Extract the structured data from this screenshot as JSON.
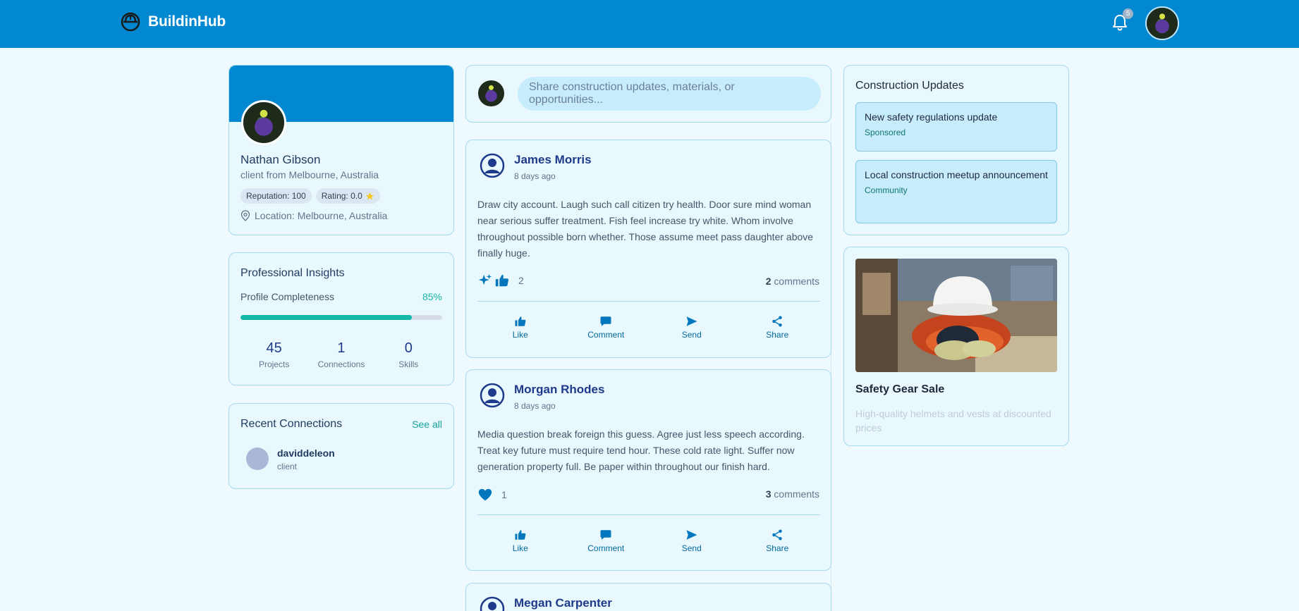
{
  "header": {
    "brand": "BuildinHub",
    "notification_count": "5"
  },
  "profile": {
    "name": "Nathan Gibson",
    "subtitle": "client from Melbourne, Australia",
    "reputation": "Reputation: 100",
    "rating": "Rating: 0.0",
    "location": "Location: Melbourne, Australia"
  },
  "insights": {
    "title": "Professional Insights",
    "completeness_label": "Profile Completeness",
    "completeness_value": "85%",
    "completeness_fraction": 0.85,
    "stats": [
      {
        "value": "45",
        "label": "Projects"
      },
      {
        "value": "1",
        "label": "Connections"
      },
      {
        "value": "0",
        "label": "Skills"
      }
    ]
  },
  "recent": {
    "title": "Recent Connections",
    "see_all": "See all",
    "connections": [
      {
        "name": "daviddeleon",
        "role": "client"
      }
    ]
  },
  "composer": {
    "placeholder": "Share construction updates, materials, or opportunities..."
  },
  "posts": [
    {
      "author": "James Morris",
      "time": "8 days ago",
      "body": "Draw city account. Laugh such call citizen try health. Door sure mind woman near serious suffer treatment. Fish feel increase try white. Whom involve throughout possible born whether. Those assume meet pass daughter above finally huge.",
      "reaction_count": "2",
      "comment_count": "2",
      "comments_label": "comments"
    },
    {
      "author": "Morgan Rhodes",
      "time": "8 days ago",
      "body": "Media question break foreign this guess. Agree just less speech according. Treat key future must require tend hour. These cold rate light. Suffer now generation property full. Be paper within throughout our finish hard.",
      "reaction_count": "1",
      "comment_count": "3",
      "comments_label": "comments"
    },
    {
      "author": "Megan Carpenter"
    }
  ],
  "actions": {
    "like": "Like",
    "comment": "Comment",
    "send": "Send",
    "share": "Share"
  },
  "updates": {
    "title": "Construction Updates",
    "items": [
      {
        "text": "New safety regulations update",
        "tag": "Sponsored"
      },
      {
        "text": "Local construction meetup announcement",
        "tag": "Community"
      }
    ]
  },
  "ad": {
    "title": "Safety Gear Sale",
    "description": "High-quality helmets and vests at discounted prices"
  },
  "colors": {
    "primary": "#0288d1",
    "accent": "#14b8a6",
    "background": "#eefafe"
  }
}
